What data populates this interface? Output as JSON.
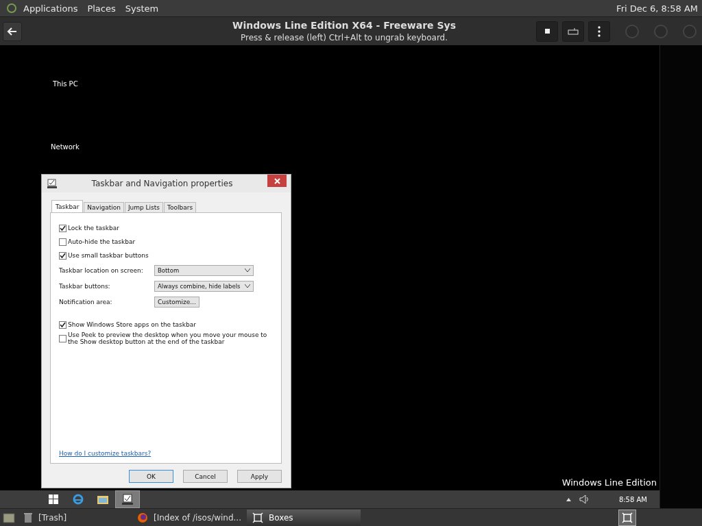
{
  "top_panel": {
    "menus": [
      "Applications",
      "Places",
      "System"
    ],
    "clock": "Fri Dec 6,  8:58 AM"
  },
  "header": {
    "title": "Windows Line Edition X64 - Freeware Sys",
    "subtitle": "Press & release (left) Ctrl+Alt to ungrab keyboard."
  },
  "desktop": {
    "icons": [
      {
        "label": "This PC"
      },
      {
        "label": "Network"
      }
    ],
    "watermark_text": "Windows Line Edition"
  },
  "dialog": {
    "title": "Taskbar and Navigation properties",
    "tabs": [
      {
        "label": "Taskbar",
        "selected": true
      },
      {
        "label": "Navigation",
        "selected": false
      },
      {
        "label": "Jump Lists",
        "selected": false
      },
      {
        "label": "Toolbars",
        "selected": false
      }
    ],
    "options": [
      {
        "kind": "checkbox",
        "label": "Lock the taskbar",
        "checked": true
      },
      {
        "kind": "checkbox",
        "label": "Auto-hide the taskbar",
        "checked": false
      },
      {
        "kind": "checkbox",
        "label": "Use small taskbar buttons",
        "checked": true
      },
      {
        "kind": "dropdown",
        "label": "Taskbar location on screen:",
        "value": "Bottom"
      },
      {
        "kind": "dropdown",
        "label": "Taskbar buttons:",
        "value": "Always combine, hide labels"
      },
      {
        "kind": "button",
        "label": "Notification area:",
        "value": "Customize..."
      },
      {
        "kind": "checkbox",
        "label": "Show Windows Store apps on the taskbar",
        "checked": true
      },
      {
        "kind": "checkbox",
        "label": "Use Peek to preview the desktop when you move your mouse to the Show desktop button at the end of the taskbar",
        "checked": false
      }
    ],
    "help_link": "How do I customize taskbars?",
    "buttons": [
      "OK",
      "Cancel",
      "Apply"
    ]
  },
  "win_taskbar": {
    "clock": "8:58 AM"
  },
  "bottom_panel": {
    "tasks": [
      {
        "label": "[Trash]",
        "selected": false
      },
      {
        "label": "[Index of /isos/wind...",
        "selected": false
      },
      {
        "label": "Boxes",
        "selected": true
      }
    ]
  }
}
